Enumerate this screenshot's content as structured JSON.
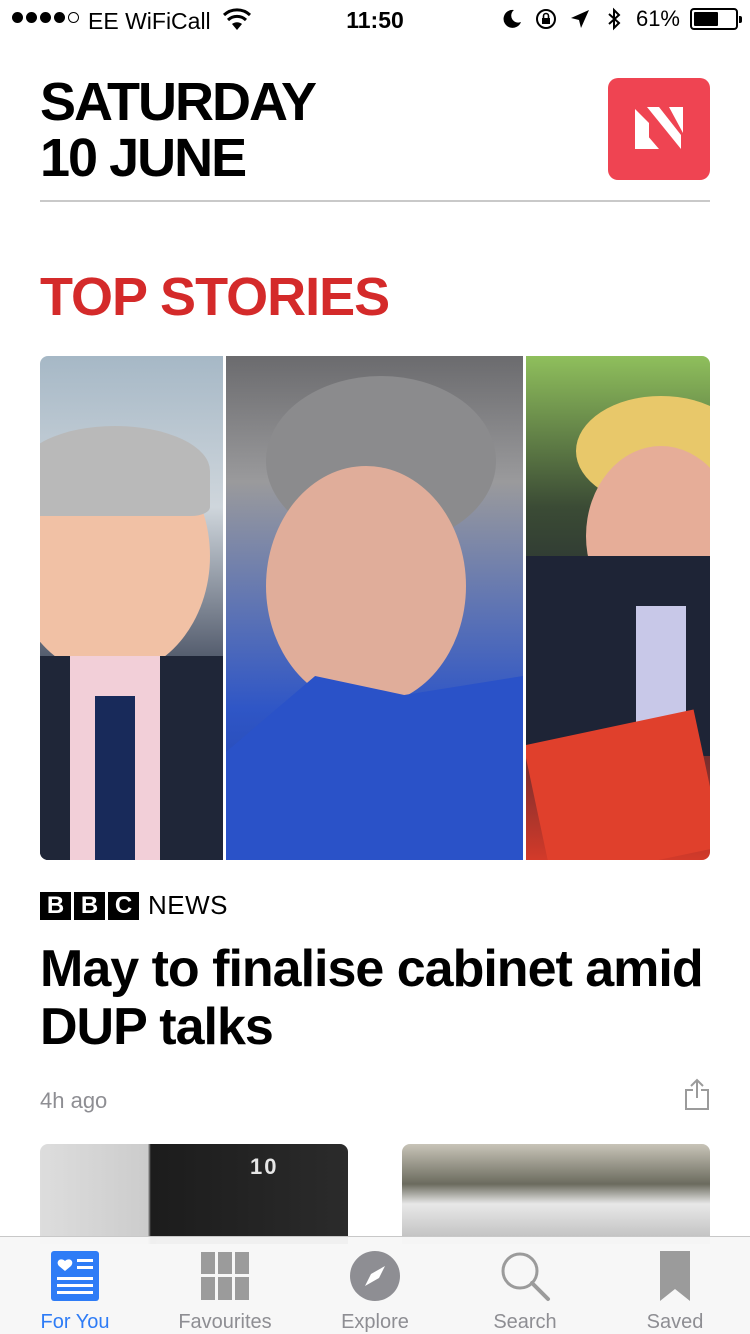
{
  "status_bar": {
    "carrier": "EE WiFiCall",
    "time": "11:50",
    "battery_percent": "61%",
    "battery_level": 0.61,
    "signal_bars": 4,
    "icons": [
      "wifi-icon",
      "moon-icon",
      "rotation-lock-icon",
      "location-arrow-icon",
      "bluetooth-icon",
      "battery-icon"
    ]
  },
  "header": {
    "day": "SATURDAY",
    "date": "10 JUNE",
    "logo_icon": "apple-news-icon",
    "logo_color": "#ef4452"
  },
  "section": {
    "title": "TOP STORIES",
    "color": "#d42a2a"
  },
  "top_story": {
    "source_letters": [
      "B",
      "B",
      "C"
    ],
    "source_suffix": "NEWS",
    "headline": "May to finalise cabinet amid DUP talks",
    "timestamp": "4h ago",
    "share_icon": "share-icon"
  },
  "thumbnails": [
    {
      "door_number": "10"
    },
    {}
  ],
  "tab_bar": {
    "active_color": "#2e7cf6",
    "inactive_color": "#8e8e93",
    "tabs": [
      {
        "label": "For You",
        "icon": "for-you-icon",
        "active": true
      },
      {
        "label": "Favourites",
        "icon": "favourites-grid-icon",
        "active": false
      },
      {
        "label": "Explore",
        "icon": "compass-icon",
        "active": false
      },
      {
        "label": "Search",
        "icon": "search-icon",
        "active": false
      },
      {
        "label": "Saved",
        "icon": "bookmark-icon",
        "active": false
      }
    ]
  }
}
